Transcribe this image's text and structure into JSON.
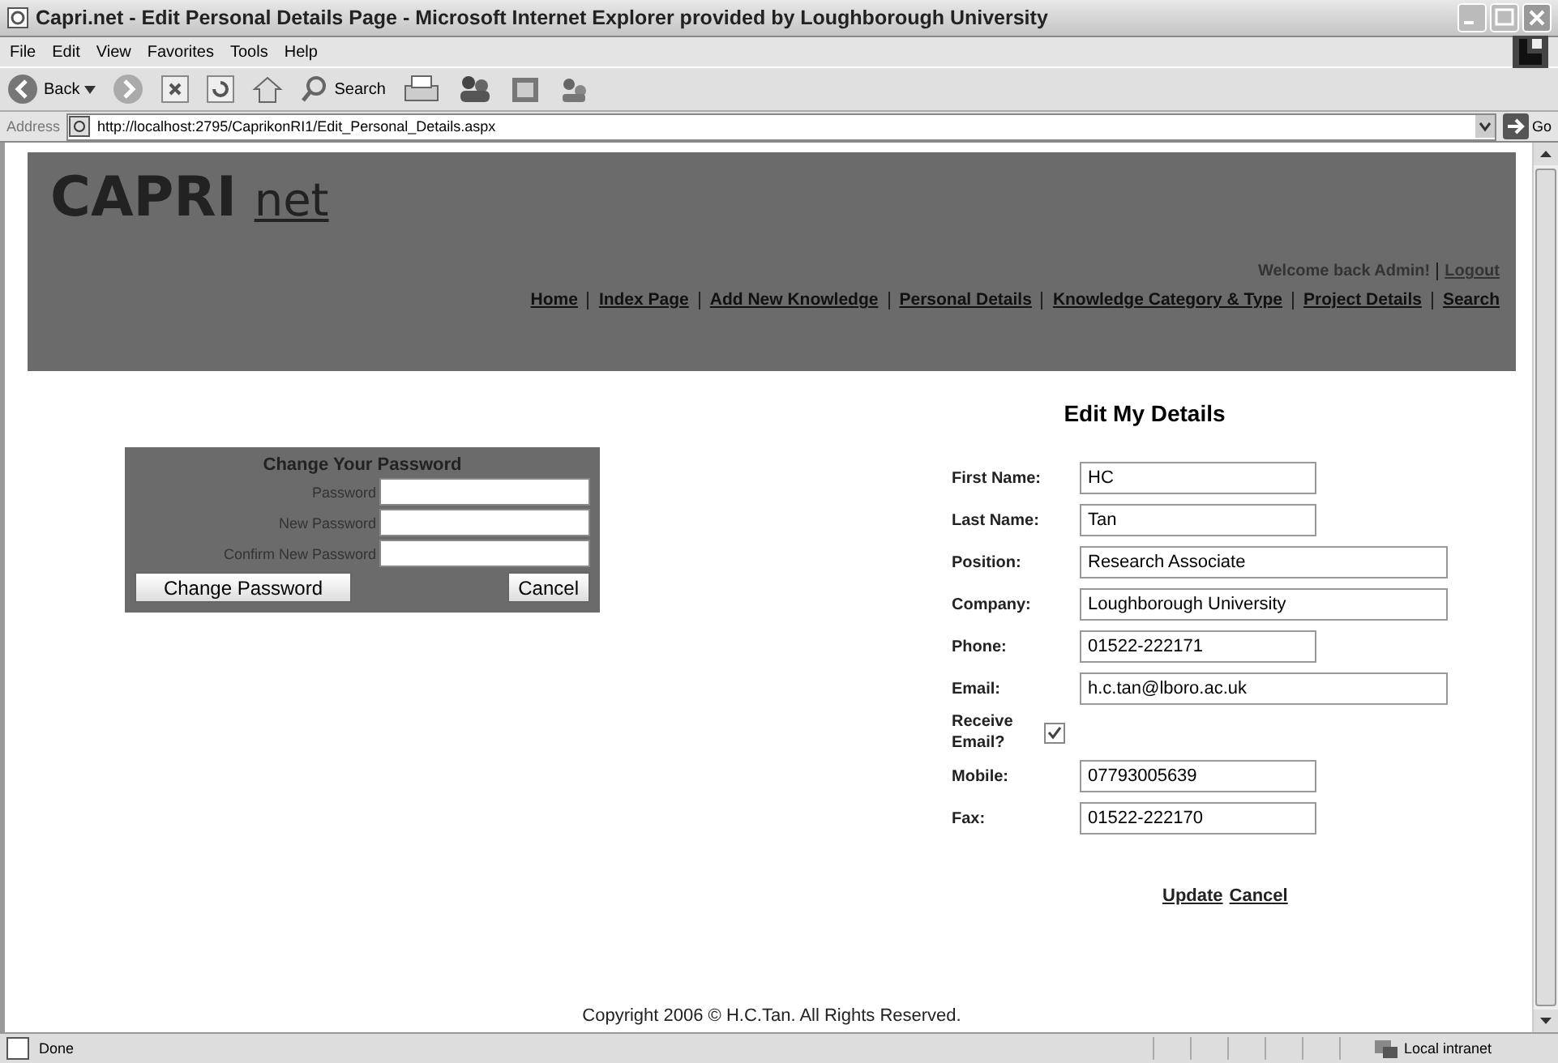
{
  "window": {
    "title": "Capri.net - Edit Personal Details Page - Microsoft Internet Explorer provided by Loughborough University"
  },
  "menu": [
    "File",
    "Edit",
    "View",
    "Favorites",
    "Tools",
    "Help"
  ],
  "toolbar": {
    "back": "Back",
    "search": "Search"
  },
  "address": {
    "label": "Address",
    "url": "http://localhost:2795/CaprikonRI1/Edit_Personal_Details.aspx",
    "go": "Go"
  },
  "header": {
    "logo": "CAPRI",
    "logo_suffix": "net",
    "welcome": "Welcome back Admin!",
    "logout": "Logout",
    "nav": [
      "Home",
      "Index Page",
      "Add New Knowledge",
      "Personal Details",
      "Knowledge Category & Type",
      "Project Details",
      "Search"
    ]
  },
  "heading": "Edit My Details",
  "password_panel": {
    "title": "Change Your Password",
    "fields": [
      "Password",
      "New Password",
      "Confirm New Password"
    ],
    "submit": "Change Password",
    "cancel": "Cancel"
  },
  "details": [
    {
      "kind": "text",
      "label": "First Name:",
      "value": "HC",
      "wide": false
    },
    {
      "kind": "text",
      "label": "Last Name:",
      "value": "Tan",
      "wide": false
    },
    {
      "kind": "text",
      "label": "Position:",
      "value": "Research Associate",
      "wide": true
    },
    {
      "kind": "text",
      "label": "Company:",
      "value": "Loughborough University",
      "wide": true
    },
    {
      "kind": "text",
      "label": "Phone:",
      "value": "01522-222171",
      "wide": false
    },
    {
      "kind": "text",
      "label": "Email:",
      "value": "h.c.tan@lboro.ac.uk",
      "wide": true
    },
    {
      "kind": "checkbox",
      "label": "Receive Email?",
      "checked": true
    },
    {
      "kind": "text",
      "label": "Mobile:",
      "value": "07793005639",
      "wide": false
    },
    {
      "kind": "text",
      "label": "Fax:",
      "value": "01522-222170",
      "wide": false
    }
  ],
  "actions": [
    "Update",
    "Cancel"
  ],
  "footer": "Copyright 2006 © H.C.Tan. All Rights Reserved.",
  "status_bar": {
    "status": "Done",
    "zone": "Local intranet"
  }
}
